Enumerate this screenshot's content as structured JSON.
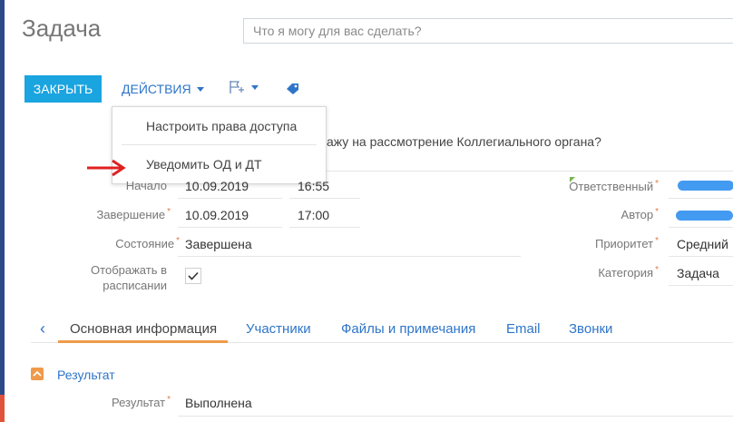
{
  "header": {
    "title": "Задача",
    "search_placeholder": "Что я могу для вас сделать?"
  },
  "toolbar": {
    "close_label": "ЗАКРЫТЬ",
    "actions_label": "ДЕЙСТВИЯ",
    "flag_icon": "flag-plus-icon",
    "tag_icon": "tag-icon"
  },
  "actions_menu": {
    "items": [
      "Настроить права доступа",
      "Уведомить ОД и ДТ"
    ]
  },
  "task": {
    "subject_fragment": "ажу на рассмотрение Коллегиального органа?"
  },
  "fields": {
    "start": {
      "label": "Начало",
      "date": "10.09.2019",
      "time": "16:55"
    },
    "end": {
      "label": "Завершение",
      "date": "10.09.2019",
      "time": "17:00"
    },
    "status": {
      "label": "Состояние",
      "value": "Завершена"
    },
    "show_in_schedule": {
      "label_line1": "Отображать в",
      "label_line2": "расписании",
      "checked": true
    },
    "owner": {
      "label": "Ответственный"
    },
    "author": {
      "label": "Автор"
    },
    "priority": {
      "label": "Приоритет",
      "value": "Средний"
    },
    "category": {
      "label": "Категория",
      "value": "Задача"
    }
  },
  "tabs": [
    "Основная информация",
    "Участники",
    "Файлы и примечания",
    "Email",
    "Звонки"
  ],
  "result_section": {
    "title": "Результат",
    "field_label": "Результат",
    "field_value": "Выполнена"
  },
  "colors": {
    "accent_blue": "#1aa4e0",
    "link_blue": "#2e75c9",
    "orange": "#ef9a4a",
    "arrow_red": "#e02020"
  }
}
